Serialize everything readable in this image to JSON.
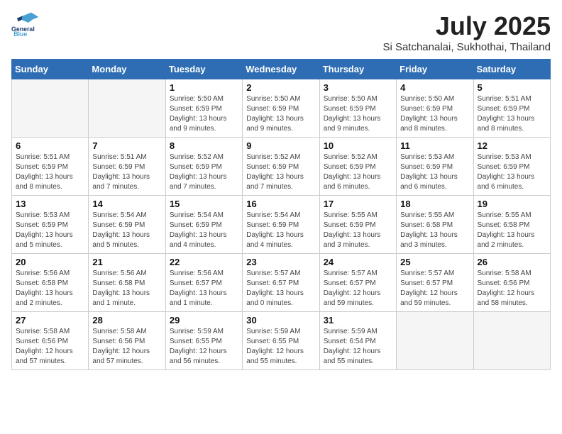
{
  "header": {
    "logo_line1": "General",
    "logo_line2": "Blue",
    "month": "July 2025",
    "location": "Si Satchanalai, Sukhothai, Thailand"
  },
  "days_of_week": [
    "Sunday",
    "Monday",
    "Tuesday",
    "Wednesday",
    "Thursday",
    "Friday",
    "Saturday"
  ],
  "weeks": [
    [
      {
        "day": "",
        "info": ""
      },
      {
        "day": "",
        "info": ""
      },
      {
        "day": "1",
        "info": "Sunrise: 5:50 AM\nSunset: 6:59 PM\nDaylight: 13 hours\nand 9 minutes."
      },
      {
        "day": "2",
        "info": "Sunrise: 5:50 AM\nSunset: 6:59 PM\nDaylight: 13 hours\nand 9 minutes."
      },
      {
        "day": "3",
        "info": "Sunrise: 5:50 AM\nSunset: 6:59 PM\nDaylight: 13 hours\nand 9 minutes."
      },
      {
        "day": "4",
        "info": "Sunrise: 5:50 AM\nSunset: 6:59 PM\nDaylight: 13 hours\nand 8 minutes."
      },
      {
        "day": "5",
        "info": "Sunrise: 5:51 AM\nSunset: 6:59 PM\nDaylight: 13 hours\nand 8 minutes."
      }
    ],
    [
      {
        "day": "6",
        "info": "Sunrise: 5:51 AM\nSunset: 6:59 PM\nDaylight: 13 hours\nand 8 minutes."
      },
      {
        "day": "7",
        "info": "Sunrise: 5:51 AM\nSunset: 6:59 PM\nDaylight: 13 hours\nand 7 minutes."
      },
      {
        "day": "8",
        "info": "Sunrise: 5:52 AM\nSunset: 6:59 PM\nDaylight: 13 hours\nand 7 minutes."
      },
      {
        "day": "9",
        "info": "Sunrise: 5:52 AM\nSunset: 6:59 PM\nDaylight: 13 hours\nand 7 minutes."
      },
      {
        "day": "10",
        "info": "Sunrise: 5:52 AM\nSunset: 6:59 PM\nDaylight: 13 hours\nand 6 minutes."
      },
      {
        "day": "11",
        "info": "Sunrise: 5:53 AM\nSunset: 6:59 PM\nDaylight: 13 hours\nand 6 minutes."
      },
      {
        "day": "12",
        "info": "Sunrise: 5:53 AM\nSunset: 6:59 PM\nDaylight: 13 hours\nand 6 minutes."
      }
    ],
    [
      {
        "day": "13",
        "info": "Sunrise: 5:53 AM\nSunset: 6:59 PM\nDaylight: 13 hours\nand 5 minutes."
      },
      {
        "day": "14",
        "info": "Sunrise: 5:54 AM\nSunset: 6:59 PM\nDaylight: 13 hours\nand 5 minutes."
      },
      {
        "day": "15",
        "info": "Sunrise: 5:54 AM\nSunset: 6:59 PM\nDaylight: 13 hours\nand 4 minutes."
      },
      {
        "day": "16",
        "info": "Sunrise: 5:54 AM\nSunset: 6:59 PM\nDaylight: 13 hours\nand 4 minutes."
      },
      {
        "day": "17",
        "info": "Sunrise: 5:55 AM\nSunset: 6:59 PM\nDaylight: 13 hours\nand 3 minutes."
      },
      {
        "day": "18",
        "info": "Sunrise: 5:55 AM\nSunset: 6:58 PM\nDaylight: 13 hours\nand 3 minutes."
      },
      {
        "day": "19",
        "info": "Sunrise: 5:55 AM\nSunset: 6:58 PM\nDaylight: 13 hours\nand 2 minutes."
      }
    ],
    [
      {
        "day": "20",
        "info": "Sunrise: 5:56 AM\nSunset: 6:58 PM\nDaylight: 13 hours\nand 2 minutes."
      },
      {
        "day": "21",
        "info": "Sunrise: 5:56 AM\nSunset: 6:58 PM\nDaylight: 13 hours\nand 1 minute."
      },
      {
        "day": "22",
        "info": "Sunrise: 5:56 AM\nSunset: 6:57 PM\nDaylight: 13 hours\nand 1 minute."
      },
      {
        "day": "23",
        "info": "Sunrise: 5:57 AM\nSunset: 6:57 PM\nDaylight: 13 hours\nand 0 minutes."
      },
      {
        "day": "24",
        "info": "Sunrise: 5:57 AM\nSunset: 6:57 PM\nDaylight: 12 hours\nand 59 minutes."
      },
      {
        "day": "25",
        "info": "Sunrise: 5:57 AM\nSunset: 6:57 PM\nDaylight: 12 hours\nand 59 minutes."
      },
      {
        "day": "26",
        "info": "Sunrise: 5:58 AM\nSunset: 6:56 PM\nDaylight: 12 hours\nand 58 minutes."
      }
    ],
    [
      {
        "day": "27",
        "info": "Sunrise: 5:58 AM\nSunset: 6:56 PM\nDaylight: 12 hours\nand 57 minutes."
      },
      {
        "day": "28",
        "info": "Sunrise: 5:58 AM\nSunset: 6:56 PM\nDaylight: 12 hours\nand 57 minutes."
      },
      {
        "day": "29",
        "info": "Sunrise: 5:59 AM\nSunset: 6:55 PM\nDaylight: 12 hours\nand 56 minutes."
      },
      {
        "day": "30",
        "info": "Sunrise: 5:59 AM\nSunset: 6:55 PM\nDaylight: 12 hours\nand 55 minutes."
      },
      {
        "day": "31",
        "info": "Sunrise: 5:59 AM\nSunset: 6:54 PM\nDaylight: 12 hours\nand 55 minutes."
      },
      {
        "day": "",
        "info": ""
      },
      {
        "day": "",
        "info": ""
      }
    ]
  ]
}
